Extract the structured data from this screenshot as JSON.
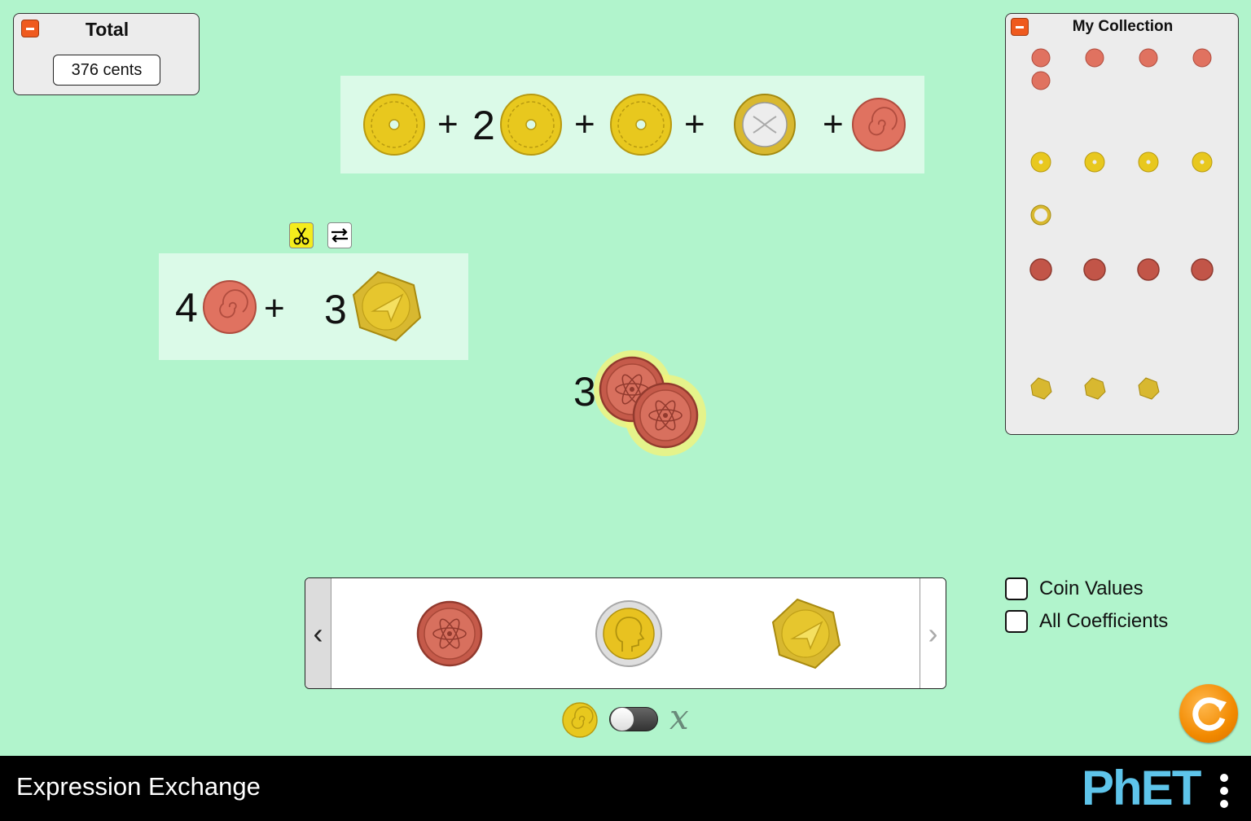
{
  "total_panel": {
    "title": "Total",
    "value": "376 cents"
  },
  "collection_panel": {
    "title": "My Collection"
  },
  "expression_top": {
    "terms": [
      {
        "coefficient": "",
        "coin": "yellow-ring-coin"
      },
      {
        "operator": "+",
        "coefficient": "2",
        "coin": "yellow-ring-coin"
      },
      {
        "operator": "+",
        "coefficient": "",
        "coin": "yellow-ring-coin"
      },
      {
        "operator": "+",
        "coefficient": "",
        "coin": "silver-dna-coin"
      },
      {
        "operator": "+",
        "coefficient": "",
        "coin": "red-spiral-coin"
      }
    ]
  },
  "expression_left": {
    "terms": [
      {
        "coefficient": "4",
        "coin": "red-spiral-coin"
      },
      {
        "operator": "+",
        "coefficient": "3",
        "coin": "gold-hexagon-coin"
      }
    ]
  },
  "loose_term": {
    "coefficient": "3",
    "coin": "red-atom-coin"
  },
  "carousel": {
    "coins": [
      "red-atom-coin",
      "silver-face-coin",
      "gold-hexagon-coin"
    ],
    "prev": "‹",
    "next": "›"
  },
  "options": {
    "coin_values": "Coin Values",
    "all_coefficients": "All Coefficients"
  },
  "mode_toggle": {
    "variable_label": "x"
  },
  "navbar": {
    "app_title": "Expression Exchange",
    "brand": "PhET"
  },
  "colors": {
    "background": "#b1f4cc",
    "expression_bg": "#dbfae8",
    "red_coin": "#e07260",
    "dark_red_coin": "#c25548",
    "yellow_coin": "#e8c81e",
    "accent_orange": "#ef5a1e"
  }
}
